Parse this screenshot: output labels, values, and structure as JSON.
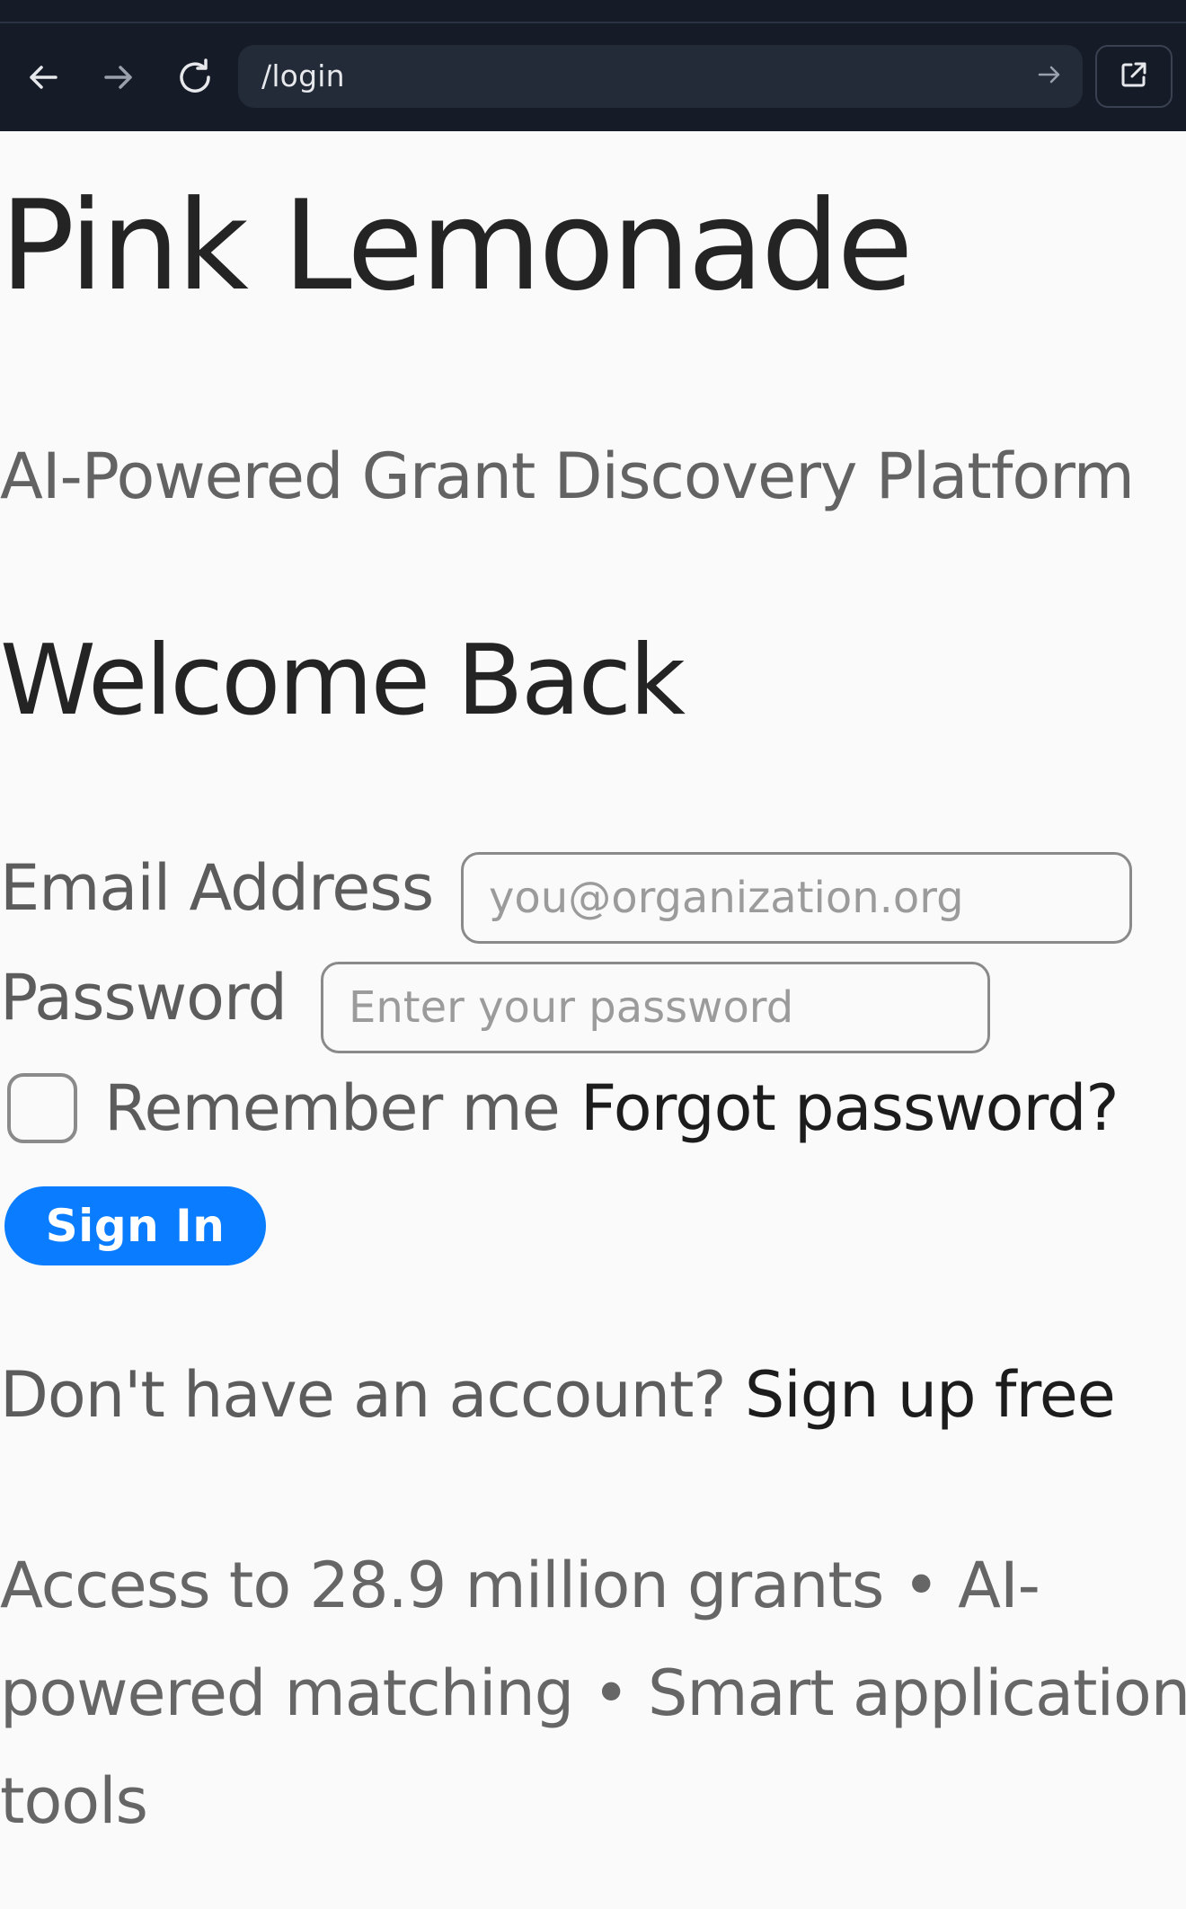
{
  "browser": {
    "url": "/login",
    "icons": {
      "back": "arrow-left-icon",
      "forward": "arrow-right-icon",
      "reload": "reload-icon",
      "go": "arrow-right-icon",
      "open_external": "external-link-icon"
    }
  },
  "page": {
    "app_title": "Pink Lemonade",
    "tagline": "AI-Powered Grant Discovery Platform",
    "heading": "Welcome Back"
  },
  "form": {
    "email": {
      "label": "Email Address",
      "placeholder": "you@organization.org",
      "value": ""
    },
    "password": {
      "label": "Password",
      "placeholder": "Enter your password",
      "value": ""
    },
    "remember": {
      "label": "Remember me",
      "checked": false
    },
    "forgot_link": "Forgot password?",
    "submit_label": "Sign In"
  },
  "signup": {
    "prompt": "Don't have an account? ",
    "link": "Sign up free"
  },
  "footer": {
    "note": "Access to 28.9 million grants • AI-powered matching • Smart application tools"
  },
  "colors": {
    "chrome_bg": "#151b27",
    "url_bar_bg": "#232a38",
    "page_bg": "#fafafa",
    "primary_button": "#0a7cff"
  }
}
